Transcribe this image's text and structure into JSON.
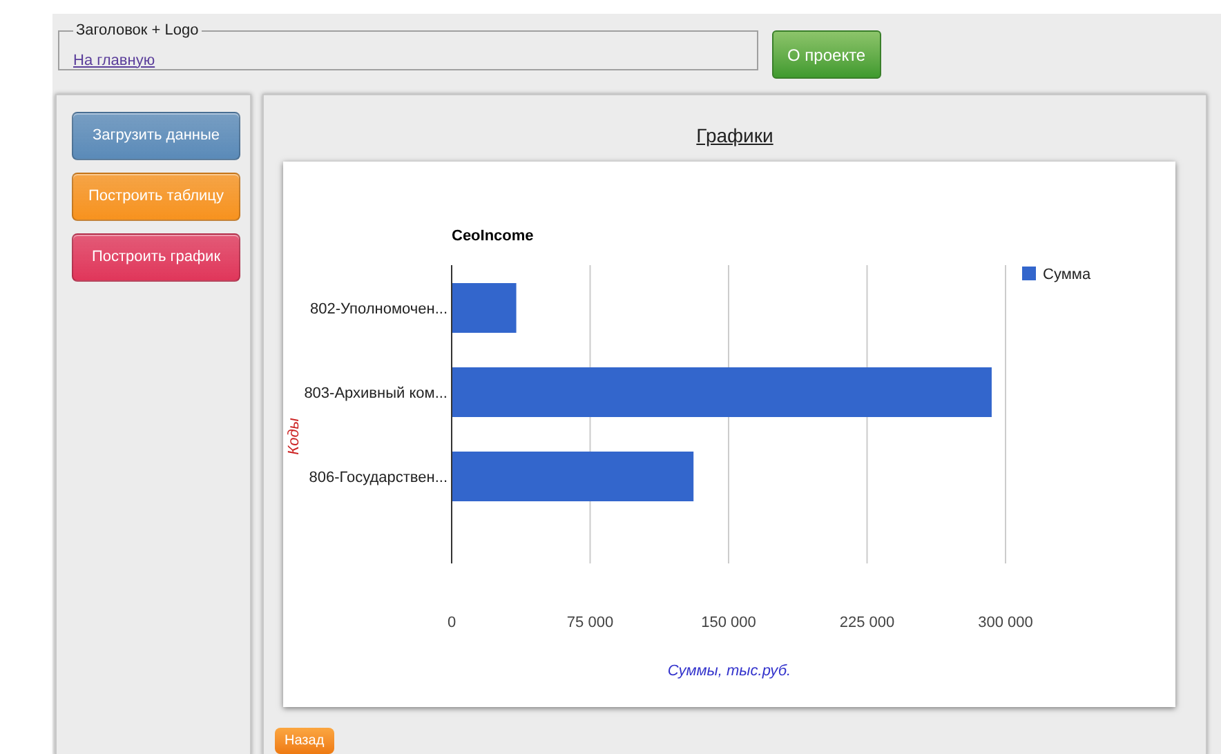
{
  "header": {
    "legend": "Заголовок + Logo",
    "home_link": "На главную",
    "about_button": "О проекте"
  },
  "sidebar": {
    "buttons": [
      {
        "label": "Загрузить данные",
        "color": "#5a8ab8"
      },
      {
        "label": "Построить таблицу",
        "color": "#f7921e"
      },
      {
        "label": "Построить график",
        "color": "#e0365a"
      }
    ]
  },
  "main": {
    "title": "Графики",
    "back_button": "Назад",
    "chart_data": {
      "type": "bar",
      "orientation": "horizontal",
      "title": "CeoIncome",
      "xlabel": "Суммы, тыс.руб.",
      "ylabel": "Коды",
      "categories": [
        "802-Уполномочен...",
        "803-Архивный ком...",
        "806-Государствен..."
      ],
      "series": [
        {
          "name": "Сумма",
          "color": "#3366cc",
          "values": [
            35000,
            292500,
            131000
          ]
        }
      ],
      "xlim": [
        0,
        300000
      ],
      "grid": true,
      "xticks": [
        {
          "value": 0,
          "label": "0"
        },
        {
          "value": 75000,
          "label": "75 000"
        },
        {
          "value": 150000,
          "label": "150 000"
        },
        {
          "value": 225000,
          "label": "225 000"
        },
        {
          "value": 300000,
          "label": "300 000"
        }
      ]
    }
  }
}
